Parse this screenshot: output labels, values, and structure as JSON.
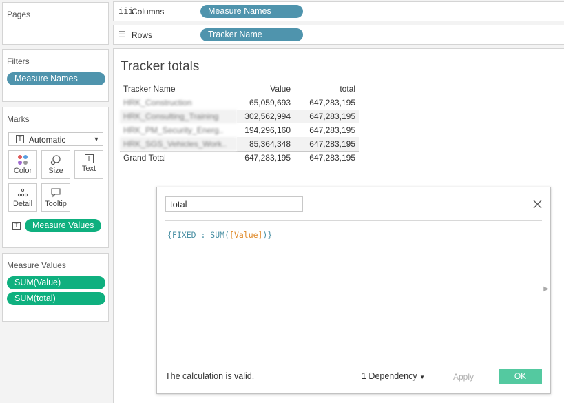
{
  "left_panel": {
    "pages": {
      "title": "Pages"
    },
    "filters": {
      "title": "Filters",
      "pills": [
        "Measure Names"
      ]
    },
    "marks": {
      "title": "Marks",
      "type_select": "Automatic",
      "buttons": [
        {
          "label": "Color",
          "icon": "color-dots-icon"
        },
        {
          "label": "Size",
          "icon": "size-icon"
        },
        {
          "label": "Text",
          "icon": "text-icon"
        },
        {
          "label": "Detail",
          "icon": "detail-icon"
        },
        {
          "label": "Tooltip",
          "icon": "tooltip-icon"
        }
      ],
      "text_pill": "Measure Values"
    },
    "measure_values": {
      "title": "Measure Values",
      "pills": [
        "SUM(Value)",
        "SUM(total)"
      ]
    }
  },
  "shelves": {
    "columns": {
      "label": "Columns",
      "pill": "Measure Names"
    },
    "rows": {
      "label": "Rows",
      "pill": "Tracker Name"
    }
  },
  "view": {
    "title": "Tracker totals",
    "headers": [
      "Tracker Name",
      "Value",
      "total"
    ],
    "rows": [
      {
        "name": "HRK_Construction",
        "value": "65,059,693",
        "total": "647,283,195"
      },
      {
        "name": "HRK_Consulting_Training",
        "value": "302,562,994",
        "total": "647,283,195"
      },
      {
        "name": "HRK_PM_Security_Energ..",
        "value": "194,296,160",
        "total": "647,283,195"
      },
      {
        "name": "HRK_SGS_Vehicles_Work..",
        "value": "85,364,348",
        "total": "647,283,195"
      }
    ],
    "grand_total": {
      "label": "Grand Total",
      "value": "647,283,195",
      "total": "647,283,195"
    }
  },
  "calc_dialog": {
    "name": "total",
    "formula": {
      "open": "{FIXED : SUM(",
      "field": "[Value]",
      "close": ")}"
    },
    "status": "The calculation is valid.",
    "dependency": "1 Dependency",
    "apply": "Apply",
    "ok": "OK"
  },
  "colors": {
    "pill_blue": "#4f94ad",
    "pill_green": "#0fb07f",
    "formula_keyword": "#4a90a4",
    "formula_field": "#e08a2a"
  }
}
